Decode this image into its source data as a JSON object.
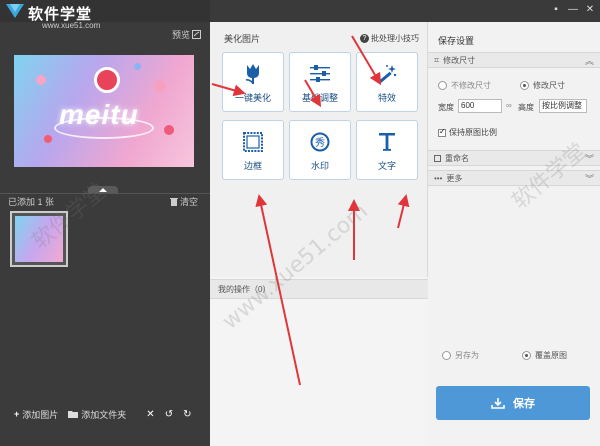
{
  "app": {
    "brand": "软件学堂",
    "brand_url": "www.xue51.com"
  },
  "left": {
    "preview_label": "预览",
    "added_label": "已添加 1 张",
    "clear_label": "清空",
    "add_image_label": "添加图片",
    "add_folder_label": "添加文件夹",
    "thumb_text": "meitu"
  },
  "middle": {
    "section_title": "美化图片",
    "tips_label": "批处理小技巧",
    "tools": [
      {
        "label": "一键美化",
        "icon": "tulip-icon"
      },
      {
        "label": "基础调整",
        "icon": "sliders-icon"
      },
      {
        "label": "特效",
        "icon": "magic-wand-icon"
      },
      {
        "label": "边框",
        "icon": "frame-icon"
      },
      {
        "label": "水印",
        "icon": "watermark-icon"
      },
      {
        "label": "文字",
        "icon": "text-icon"
      }
    ],
    "ops_label": "我的操作（0）"
  },
  "right": {
    "title": "保存设置",
    "resize_header": "修改尺寸",
    "no_resize_label": "不修改尺寸",
    "resize_label": "修改尺寸",
    "width_label": "宽度",
    "width_value": "600",
    "height_label": "高度",
    "height_mode": "按比例调整",
    "keep_ratio_label": "保持原图比例",
    "rename_header": "重命名",
    "more_header": "更多",
    "save_as_label": "另存为",
    "overwrite_label": "覆盖原图",
    "save_button": "保存"
  },
  "watermark": {
    "site": "www.xue51.com",
    "brand": "软件学堂"
  },
  "colors": {
    "accent": "#4f98d8",
    "arrow": "#e0363a",
    "tool_label": "#1a4f85"
  }
}
